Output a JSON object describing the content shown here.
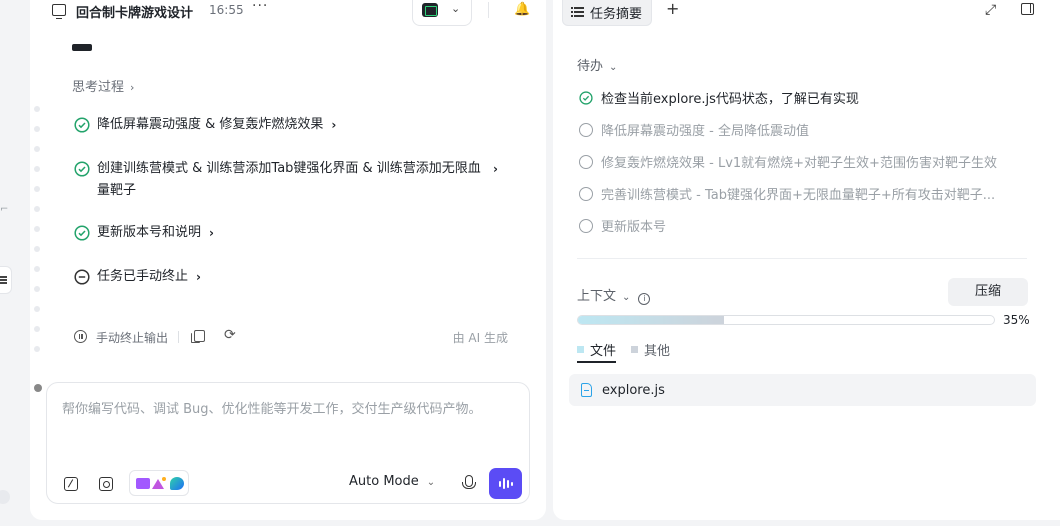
{
  "colors": {
    "accent": "#5b4cf5",
    "check_green": "#23a36b",
    "pending_gray": "#9aa0a6",
    "legend_file": "#bde7f2",
    "legend_other": "#cdd3db"
  },
  "header": {
    "title": "回合制卡牌游戏设计",
    "time": "16:55",
    "more": "···",
    "pill_chevron": "⌄",
    "bell": "🔔"
  },
  "thinking": {
    "label": "思考过程",
    "chevron": "›"
  },
  "steps": [
    {
      "status": "done",
      "text": "降低屏幕震动强度 & 修复轰炸燃烧效果"
    },
    {
      "status": "done",
      "text": "创建训练营模式 & 训练营添加Tab键强化界面 & 训练营添加无限血量靶子"
    },
    {
      "status": "done",
      "text": "更新版本号和说明"
    },
    {
      "status": "stopped",
      "text": "任务已手动终止"
    }
  ],
  "step_chevron": "›",
  "action_bar": {
    "stop_output": "手动终止输出",
    "refresh": "⟳",
    "ai_generated": "由 AI 生成"
  },
  "input": {
    "placeholder": "帮你编写代码、调试 Bug、优化性能等开发工作，交付生产级代码产物。",
    "mode": "Auto Mode",
    "mode_chevron": "⌄"
  },
  "right_panel": {
    "tab_label": "任务摘要",
    "add": "+",
    "expand": "⤢",
    "todo_header": "待办",
    "todo_chevron": "⌄",
    "todos": [
      {
        "status": "done",
        "text": "检查当前explore.js代码状态，了解已有实现"
      },
      {
        "status": "pending",
        "text": "降低屏幕震动强度 - 全局降低震动值"
      },
      {
        "status": "pending",
        "text": "修复轰炸燃烧效果 - Lv1就有燃烧+对靶子生效+范围伤害对靶子生效"
      },
      {
        "status": "pending",
        "text": "完善训练营模式 - Tab键强化界面+无限血量靶子+所有攻击对靶子..."
      },
      {
        "status": "pending",
        "text": "更新版本号"
      }
    ],
    "context": {
      "label": "上下文",
      "chevron": "⌄",
      "info": "i",
      "compress": "压缩",
      "progress_percent": 35,
      "progress_label": "35%",
      "legend": {
        "files": "文件",
        "other": "其他"
      }
    },
    "files": [
      {
        "name": "explore.js"
      }
    ]
  }
}
